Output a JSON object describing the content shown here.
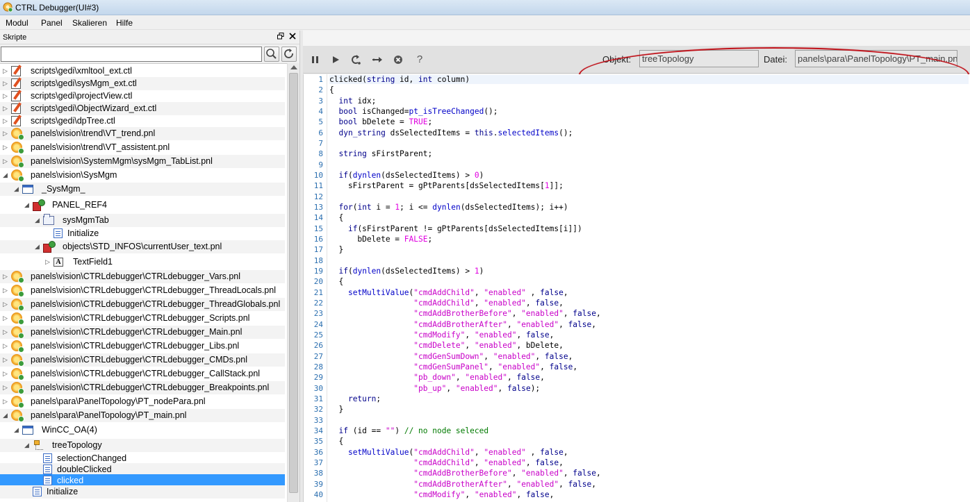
{
  "window": {
    "title": "CTRL Debugger(UI#3)"
  },
  "menu": [
    "Modul",
    "Panel",
    "Skalieren",
    "Hilfe"
  ],
  "scripts_panel": {
    "title": "Skripte",
    "search": {
      "value": "",
      "placeholder": ""
    },
    "icons": {
      "search": "search-icon",
      "refresh": "refresh-icon",
      "float": "float-icon",
      "close": "close-icon"
    },
    "tree": [
      {
        "label": "scripts\\gedi\\xmltool_ext.ctl",
        "depth": 0,
        "expand": "collapsed",
        "icon": "script"
      },
      {
        "label": "scripts\\gedi\\sysMgm_ext.ctl",
        "depth": 0,
        "expand": "collapsed",
        "icon": "script"
      },
      {
        "label": "scripts\\gedi\\projectView.ctl",
        "depth": 0,
        "expand": "collapsed",
        "icon": "script"
      },
      {
        "label": "scripts\\gedi\\ObjectWizard_ext.ctl",
        "depth": 0,
        "expand": "collapsed",
        "icon": "script"
      },
      {
        "label": "scripts\\gedi\\dpTree.ctl",
        "depth": 0,
        "expand": "collapsed",
        "icon": "script"
      },
      {
        "label": "panels\\vision\\trend\\VT_trend.pnl",
        "depth": 0,
        "expand": "collapsed",
        "icon": "gear"
      },
      {
        "label": "panels\\vision\\trend\\VT_assistent.pnl",
        "depth": 0,
        "expand": "collapsed",
        "icon": "gear"
      },
      {
        "label": "panels\\vision\\SystemMgm\\sysMgm_TabList.pnl",
        "depth": 0,
        "expand": "collapsed",
        "icon": "gear"
      },
      {
        "label": "panels\\vision\\SysMgm",
        "depth": 0,
        "expand": "expanded",
        "icon": "gear"
      },
      {
        "label": "_SysMgm_",
        "depth": 1,
        "expand": "expanded",
        "icon": "window"
      },
      {
        "label": "PANEL_REF4",
        "depth": 2,
        "expand": "expanded",
        "icon": "ref"
      },
      {
        "label": "sysMgmTab",
        "depth": 3,
        "expand": "expanded",
        "icon": "tab"
      },
      {
        "label": "Initialize",
        "depth": 4,
        "expand": "none",
        "icon": "event"
      },
      {
        "label": "objects\\STD_INFOS\\currentUser_text.pnl",
        "depth": 3,
        "expand": "expanded",
        "icon": "ref"
      },
      {
        "label": "TextField1",
        "depth": 4,
        "expand": "collapsed",
        "icon": "text"
      },
      {
        "label": "panels\\vision\\CTRLdebugger\\CTRLdebugger_Vars.pnl",
        "depth": 0,
        "expand": "collapsed",
        "icon": "gear"
      },
      {
        "label": "panels\\vision\\CTRLdebugger\\CTRLdebugger_ThreadLocals.pnl",
        "depth": 0,
        "expand": "collapsed",
        "icon": "gear"
      },
      {
        "label": "panels\\vision\\CTRLdebugger\\CTRLdebugger_ThreadGlobals.pnl",
        "depth": 0,
        "expand": "collapsed",
        "icon": "gear"
      },
      {
        "label": "panels\\vision\\CTRLdebugger\\CTRLdebugger_Scripts.pnl",
        "depth": 0,
        "expand": "collapsed",
        "icon": "gear"
      },
      {
        "label": "panels\\vision\\CTRLdebugger\\CTRLdebugger_Main.pnl",
        "depth": 0,
        "expand": "collapsed",
        "icon": "gear"
      },
      {
        "label": "panels\\vision\\CTRLdebugger\\CTRLdebugger_Libs.pnl",
        "depth": 0,
        "expand": "collapsed",
        "icon": "gear"
      },
      {
        "label": "panels\\vision\\CTRLdebugger\\CTRLdebugger_CMDs.pnl",
        "depth": 0,
        "expand": "collapsed",
        "icon": "gear"
      },
      {
        "label": "panels\\vision\\CTRLdebugger\\CTRLdebugger_CallStack.pnl",
        "depth": 0,
        "expand": "collapsed",
        "icon": "gear"
      },
      {
        "label": "panels\\vision\\CTRLdebugger\\CTRLdebugger_Breakpoints.pnl",
        "depth": 0,
        "expand": "collapsed",
        "icon": "gear"
      },
      {
        "label": "panels\\para\\PanelTopology\\PT_nodePara.pnl",
        "depth": 0,
        "expand": "collapsed",
        "icon": "gear"
      },
      {
        "label": "panels\\para\\PanelTopology\\PT_main.pnl",
        "depth": 0,
        "expand": "expanded",
        "icon": "gear"
      },
      {
        "label": "WinCC_OA(4)",
        "depth": 1,
        "expand": "expanded",
        "icon": "window"
      },
      {
        "label": "treeTopology",
        "depth": 2,
        "expand": "expanded",
        "icon": "tree"
      },
      {
        "label": "selectionChanged",
        "depth": 3,
        "expand": "none",
        "icon": "event"
      },
      {
        "label": "doubleClicked",
        "depth": 3,
        "expand": "none",
        "icon": "event"
      },
      {
        "label": "clicked",
        "depth": 3,
        "expand": "none",
        "icon": "event",
        "selected": true
      },
      {
        "label": "Initialize",
        "depth": 2,
        "expand": "none",
        "icon": "event"
      }
    ]
  },
  "toolbar": {
    "buttons": [
      "pause-icon",
      "play-icon",
      "step-into-icon",
      "step-over-icon",
      "stop-icon",
      "help-icon"
    ],
    "help_glyph": "?",
    "object_label": "Objekt:",
    "object_value": "treeTopology",
    "file_label": "Datei:",
    "file_value": "panels\\para\\PanelTopology\\PT_main.pnl"
  },
  "editor": {
    "first_line": 1,
    "lines": [
      "clicked(string id, int column)",
      "{",
      "  int idx;",
      "  bool isChanged=pt_isTreeChanged();",
      "  bool bDelete = TRUE;",
      "  dyn_string dsSelectedItems = this.selectedItems();",
      "",
      "  string sFirstParent;",
      "",
      "  if(dynlen(dsSelectedItems) > 0)",
      "    sFirstParent = gPtParents[dsSelectedItems[1]];",
      "",
      "  for(int i = 1; i <= dynlen(dsSelectedItems); i++)",
      "  {",
      "    if(sFirstParent != gPtParents[dsSelectedItems[i]])",
      "      bDelete = FALSE;",
      "  }",
      "",
      "  if(dynlen(dsSelectedItems) > 1)",
      "  {",
      "    setMultiValue(\"cmdAddChild\", \"enabled\" , false,",
      "                  \"cmdAddChild\", \"enabled\", false,",
      "                  \"cmdAddBrotherBefore\", \"enabled\", false,",
      "                  \"cmdAddBrotherAfter\", \"enabled\", false,",
      "                  \"cmdModify\", \"enabled\", false,",
      "                  \"cmdDelete\", \"enabled\", bDelete,",
      "                  \"cmdGenSumDown\", \"enabled\", false,",
      "                  \"cmdGenSumPanel\", \"enabled\", false,",
      "                  \"pb_down\", \"enabled\", false,",
      "                  \"pb_up\", \"enabled\", false);",
      "    return;",
      "  }",
      "",
      "  if (id == \"\") // no node seleced",
      "  {",
      "    setMultiValue(\"cmdAddChild\", \"enabled\" , false,",
      "                  \"cmdAddChild\", \"enabled\", false,",
      "                  \"cmdAddBrotherBefore\", \"enabled\", false,",
      "                  \"cmdAddBrotherAfter\", \"enabled\", false,",
      "                  \"cmdModify\", \"enabled\", false,"
    ]
  },
  "colors": {
    "selection": "#3399ff",
    "keyword": "#00008b",
    "function": "#0000c8",
    "string": "#c800c8",
    "number": "#e000e0",
    "comment": "#007a00",
    "line_number": "#2b6fb0",
    "annotation": "#c0141c"
  }
}
